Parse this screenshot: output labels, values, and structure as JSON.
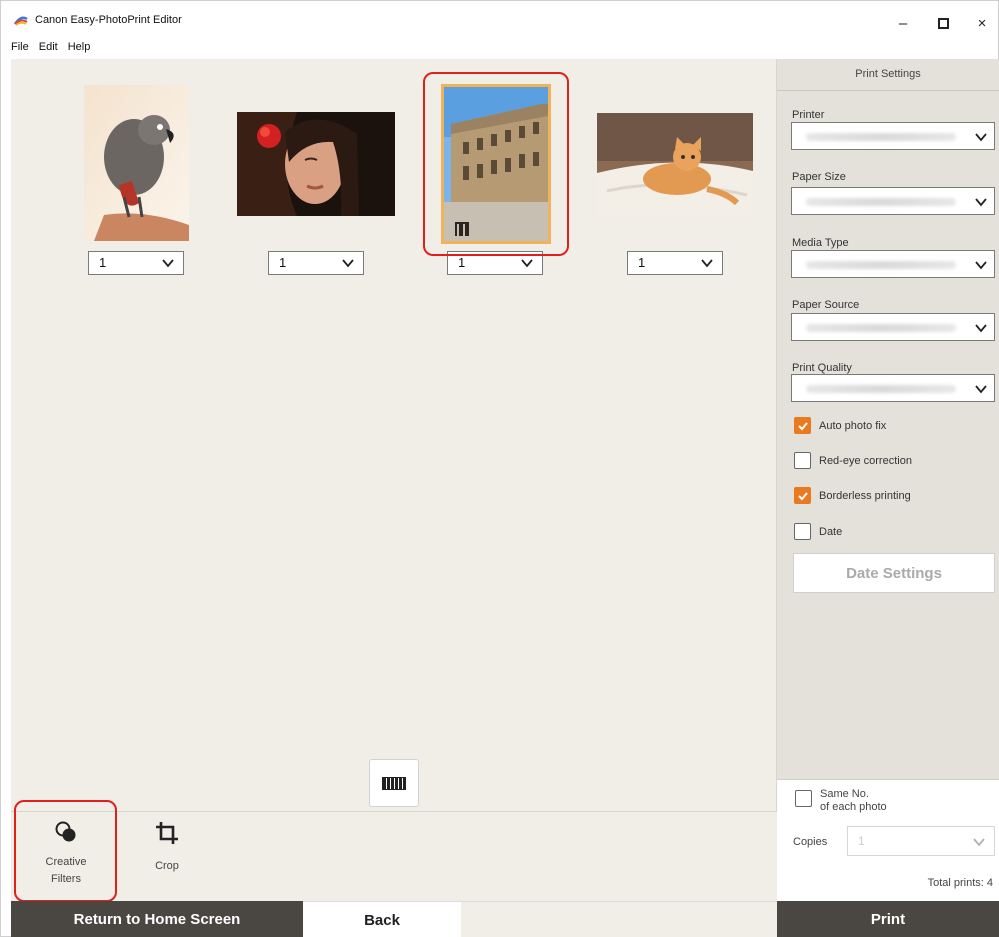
{
  "window": {
    "title": "Canon Easy-PhotoPrint Editor",
    "menu": [
      "File",
      "Edit",
      "Help"
    ],
    "controls": {
      "minimize": "–",
      "close": "×"
    }
  },
  "photos": [
    {
      "name": "parrot",
      "quantity": "1"
    },
    {
      "name": "woman",
      "quantity": "1"
    },
    {
      "name": "building",
      "quantity": "1",
      "selected": true
    },
    {
      "name": "cat",
      "quantity": "1"
    }
  ],
  "tools": {
    "creative_filters": "Creative Filters",
    "crop": "Crop"
  },
  "footer": {
    "home": "Return to Home Screen",
    "back": "Back",
    "print": "Print"
  },
  "print_settings": {
    "title": "Print Settings",
    "printer_label": "Printer",
    "paper_size_label": "Paper Size",
    "media_type_label": "Media Type",
    "paper_source_label": "Paper Source",
    "print_quality_label": "Print Quality",
    "checkboxes": [
      {
        "label": "Auto photo fix",
        "checked": true
      },
      {
        "label": "Red-eye correction",
        "checked": false
      },
      {
        "label": "Borderless printing",
        "checked": true
      },
      {
        "label": "Date",
        "checked": false
      }
    ],
    "date_settings_button": "Date Settings",
    "same_no_line1": "Same No.",
    "same_no_line2": "of each photo",
    "copies_label": "Copies",
    "copies_value": "1",
    "total_prints": "Total prints: 4"
  },
  "colors": {
    "accent": "#e97a1f",
    "highlight": "#e0201c",
    "dark_button": "#4a4743",
    "workspace": "#f1eee8"
  }
}
